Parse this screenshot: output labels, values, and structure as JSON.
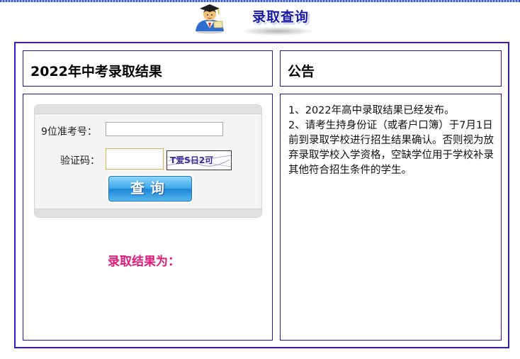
{
  "header": {
    "title": "录取查询",
    "logo_icon": "student-graduate-icon"
  },
  "left_panel": {
    "title": "2022年中考录取结果",
    "form": {
      "exam_number_label": "9位准考号：",
      "exam_number_value": "",
      "captcha_label": "验证码：",
      "captcha_value": "",
      "captcha_image_text": "T爱S日2可",
      "query_button_label": "查询"
    },
    "result_label": "录取结果为："
  },
  "right_panel": {
    "title": "公告",
    "notices": [
      "1、2022年高中录取结果已经发布。",
      "2、请考生持身份证（或者户口簿）于7月1日前到录取学校进行招生结果确认。否则视为放弃录取学校入学资格，空缺学位用于学校补录其他符合招生条件的学生。"
    ]
  },
  "colors": {
    "frame_border": "#3318d6",
    "panel_border": "#2a0fa8",
    "title_blue": "#1a1aa6",
    "result_pink": "#e01b7a"
  }
}
